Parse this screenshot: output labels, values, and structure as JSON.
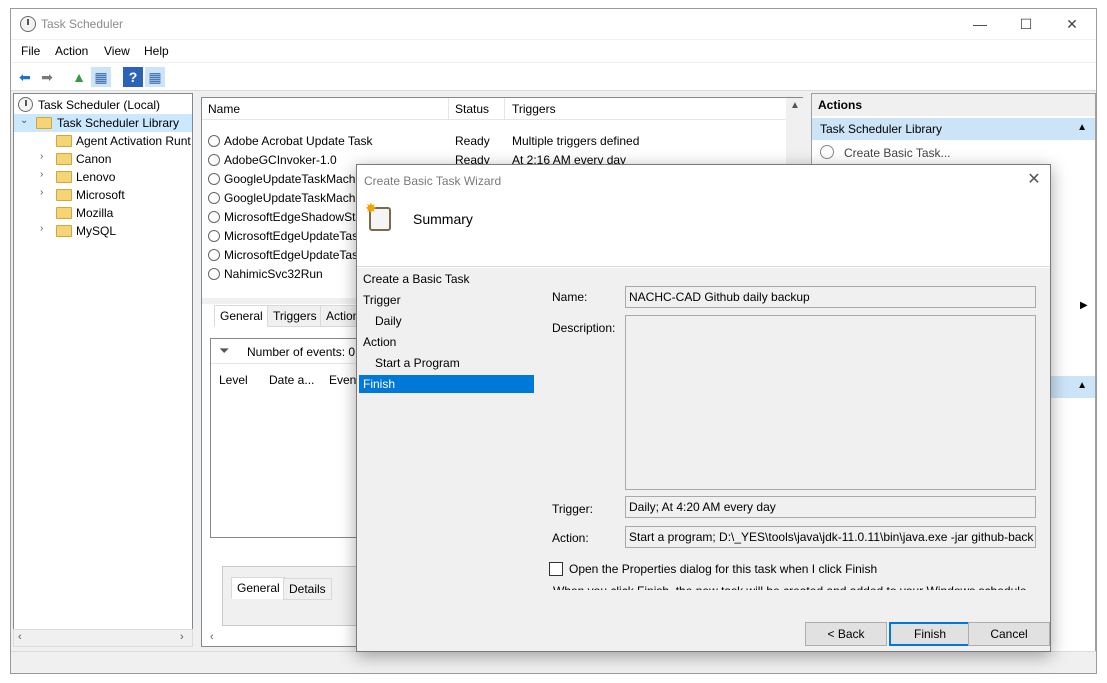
{
  "window": {
    "title": "Task Scheduler",
    "min": "—",
    "max": "☐",
    "close": "✕"
  },
  "menu": [
    "File",
    "Action",
    "View",
    "Help"
  ],
  "toolbar": {
    "back": "⬅",
    "forward": "➡",
    "up": "▲",
    "show": "▦",
    "help": "?",
    "panel": "▦"
  },
  "tree": {
    "root": "Task Scheduler (Local)",
    "library": "Task Scheduler Library",
    "children": [
      "Agent Activation Runt",
      "Canon",
      "Lenovo",
      "Microsoft",
      "Mozilla",
      "MySQL"
    ]
  },
  "task_list": {
    "columns": [
      "Name",
      "Status",
      "Triggers"
    ],
    "rows": [
      {
        "name": "Adobe Acrobat Update Task",
        "status": "Ready",
        "triggers": "Multiple triggers defined"
      },
      {
        "name": "AdobeGCInvoker-1.0",
        "status": "Ready",
        "triggers": "At 2:16 AM every day"
      },
      {
        "name": "GoogleUpdateTaskMachi",
        "status": "",
        "triggers": ""
      },
      {
        "name": "GoogleUpdateTaskMachi",
        "status": "",
        "triggers": ""
      },
      {
        "name": "MicrosoftEdgeShadowSta",
        "status": "",
        "triggers": ""
      },
      {
        "name": "MicrosoftEdgeUpdateTas",
        "status": "",
        "triggers": ""
      },
      {
        "name": "MicrosoftEdgeUpdateTas",
        "status": "",
        "triggers": ""
      },
      {
        "name": "NahimicSvc32Run",
        "status": "",
        "triggers": ""
      }
    ]
  },
  "detail_tabs": [
    "General",
    "Triggers",
    "Actions"
  ],
  "events": {
    "filter_label": "Number of events: 0",
    "columns": [
      "Level",
      "Date a...",
      "Event"
    ]
  },
  "sub_tabs": [
    "General",
    "Details"
  ],
  "actions_pane": {
    "header": "Actions",
    "group": "Task Scheduler Library",
    "items": [
      "Create Basic Task..."
    ]
  },
  "dialog": {
    "title": "Create Basic Task Wizard",
    "heading": "Summary",
    "close": "✕",
    "steps": [
      {
        "label": "Create a Basic Task",
        "indent": false,
        "selected": false
      },
      {
        "label": "Trigger",
        "indent": false,
        "selected": false
      },
      {
        "label": "Daily",
        "indent": true,
        "selected": false
      },
      {
        "label": "Action",
        "indent": false,
        "selected": false
      },
      {
        "label": "Start a Program",
        "indent": true,
        "selected": false
      },
      {
        "label": "Finish",
        "indent": false,
        "selected": true
      }
    ],
    "name_label": "Name:",
    "name_value": "NACHC-CAD Github daily backup",
    "description_label": "Description:",
    "description_value": "",
    "trigger_label": "Trigger:",
    "trigger_value": "Daily; At 4:20 AM every day",
    "action_label": "Action:",
    "action_value": "Start a program; D:\\_YES\\tools\\java\\jdk-11.0.11\\bin\\java.exe -jar github-back",
    "checkbox_label": "Open the Properties dialog for this task when I click Finish",
    "note": "When you click Finish, the new task will be created and added to your Windows schedule.",
    "buttons": {
      "back": "< Back",
      "finish": "Finish",
      "cancel": "Cancel"
    }
  }
}
